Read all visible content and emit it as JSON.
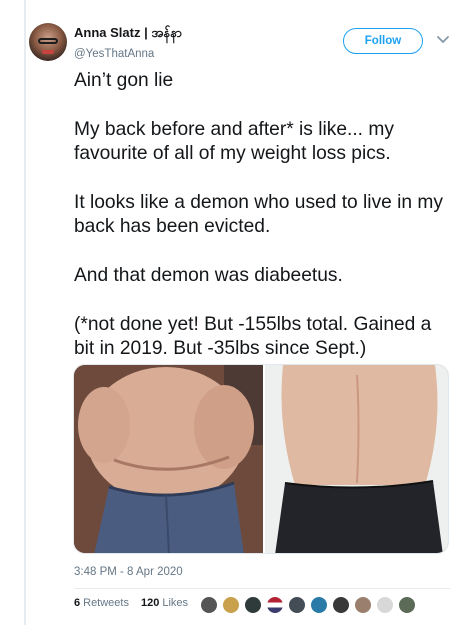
{
  "user": {
    "display_name": "Anna Slatz | အန်နာ",
    "handle": "@YesThatAnna"
  },
  "header": {
    "follow_label": "Follow",
    "menu_icon": "chevron-down-icon"
  },
  "tweet": {
    "paragraphs": [
      "Ain’t gon lie",
      "My back before and after* is like... my favourite of all of my weight loss pics.",
      "It looks like a demon who used to live in my back has been evicted.",
      "And that demon was diabeetus.",
      "(*not done yet! But -155lbs total. Gained a bit in 2019. But -35lbs since Sept.)"
    ],
    "timestamp": "3:48 PM - 8 Apr 2020"
  },
  "stats": {
    "retweets_count": "6",
    "retweets_label": "Retweets",
    "likes_count": "120",
    "likes_label": "Likes"
  },
  "colors": {
    "accent": "#1da1f2",
    "text_primary": "#14171a",
    "text_secondary": "#657786",
    "divider": "#e6ecf0"
  }
}
